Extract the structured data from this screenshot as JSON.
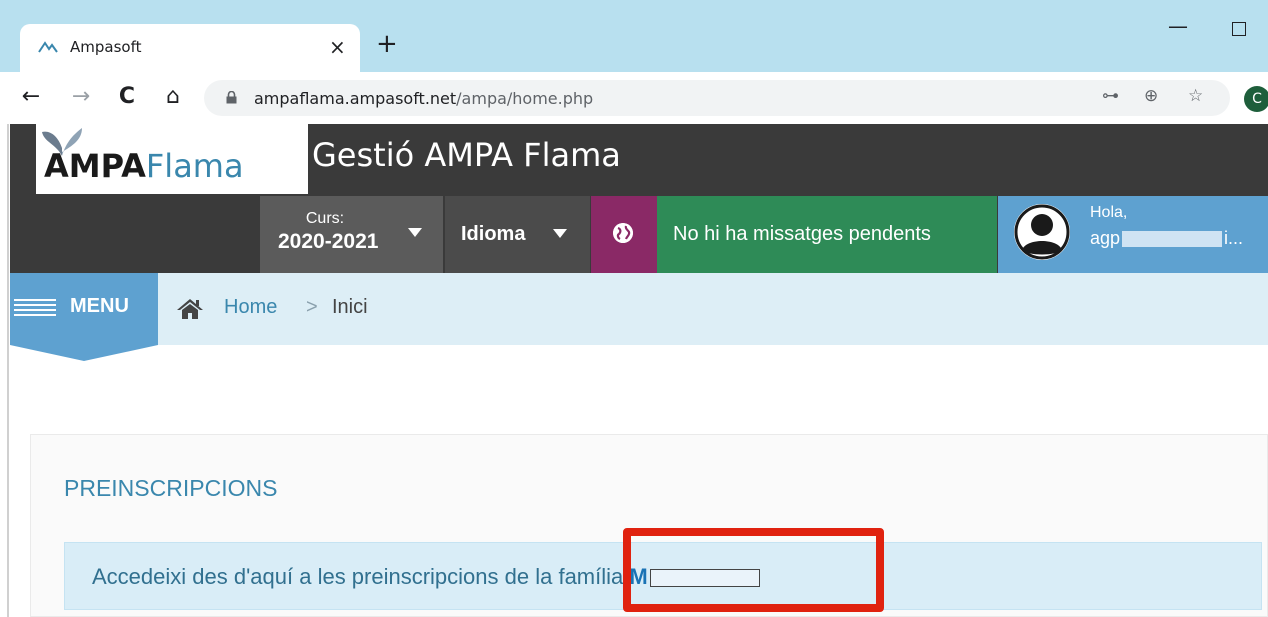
{
  "browser": {
    "tab_title": "Ampasoft",
    "tab_close": "×",
    "new_tab": "+",
    "minimize": "—",
    "url_host": "ampaflama.ampasoft.net",
    "url_path": "/ampa/home.php",
    "profile_initial": "C",
    "back": "←",
    "forward": "→",
    "reload": "C",
    "home": "⌂",
    "key_icon": "⊶",
    "zoom_icon": "⊕",
    "star_icon": "☆"
  },
  "header": {
    "logo_ampa": "AMPA",
    "logo_flama": "Flama",
    "title": "Gestió AMPA Flama"
  },
  "subbar": {
    "curs_label": "Curs:",
    "curs_value": "2020-2021",
    "idioma_label": "Idioma",
    "messages": "No hi ha missatges pendents",
    "greeting": "Hola,",
    "username_prefix": "agp",
    "username_suffix": "i..."
  },
  "breadcrumb": {
    "menu_label": "MENU",
    "home": "Home",
    "separator": ">",
    "current": "Inici"
  },
  "panel": {
    "title": "PREINSCRIPCIONS",
    "alert_text": "Accedeixi des d'aquí a les preinscripcions de la família ",
    "alert_link": "M"
  },
  "colors": {
    "accent": "#3a87ad",
    "header_bg": "#3a3a3a",
    "messages_bg": "#2e8b57",
    "globe_bg": "#8a2966",
    "user_bg": "#5ea1d0",
    "highlight": "#e0220f"
  }
}
